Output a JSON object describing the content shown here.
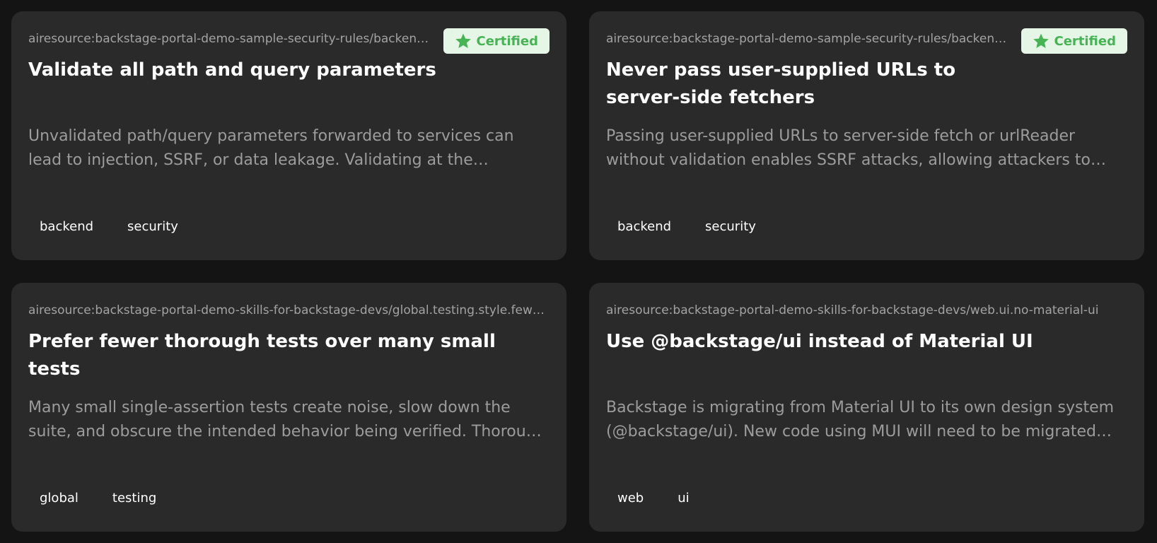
{
  "cards": [
    {
      "source": "airesource:backstage-portal-demo-sample-security-rules/backend.security.validate-path-and-query-parameters",
      "badge": "Certified",
      "title": "Validate all path and query parameters",
      "description": "Unvalidated path/query parameters forwarded to services can lead to injection, SSRF, or data leakage. Validating at the boundary…",
      "tags": [
        "backend",
        "security"
      ]
    },
    {
      "source": "airesource:backstage-portal-demo-sample-security-rules/backend.security.no-user-supplied-urls",
      "badge": "Certified",
      "title": "Never pass user-supplied URLs to server-side fetchers",
      "description": "Passing user-supplied URLs to server-side fetch or urlReader without validation enables SSRF attacks, allowing attackers to pro…",
      "tags": [
        "backend",
        "security"
      ]
    },
    {
      "source": "airesource:backstage-portal-demo-skills-for-backstage-devs/global.testing.style.fewer-thorough-tests",
      "badge": "",
      "title": "Prefer fewer thorough tests over many small tests",
      "description": "Many small single-assertion tests create noise, slow down the suite, and obscure the intended behavior being verified. Thorough tests…",
      "tags": [
        "global",
        "testing"
      ]
    },
    {
      "source": "airesource:backstage-portal-demo-skills-for-backstage-devs/web.ui.no-material-ui",
      "badge": "",
      "title": "Use @backstage/ui instead of Material UI",
      "description": "Backstage is migrating from Material UI to its own design system (@backstage/ui). New code using MUI will need to be migrated…",
      "tags": [
        "web",
        "ui"
      ]
    }
  ],
  "icons": {
    "badge": "star-icon"
  },
  "colors": {
    "background": "#141414",
    "card": "#2a2a2a",
    "badge_bg": "#e6f6e6",
    "badge_fg": "#46b454"
  }
}
